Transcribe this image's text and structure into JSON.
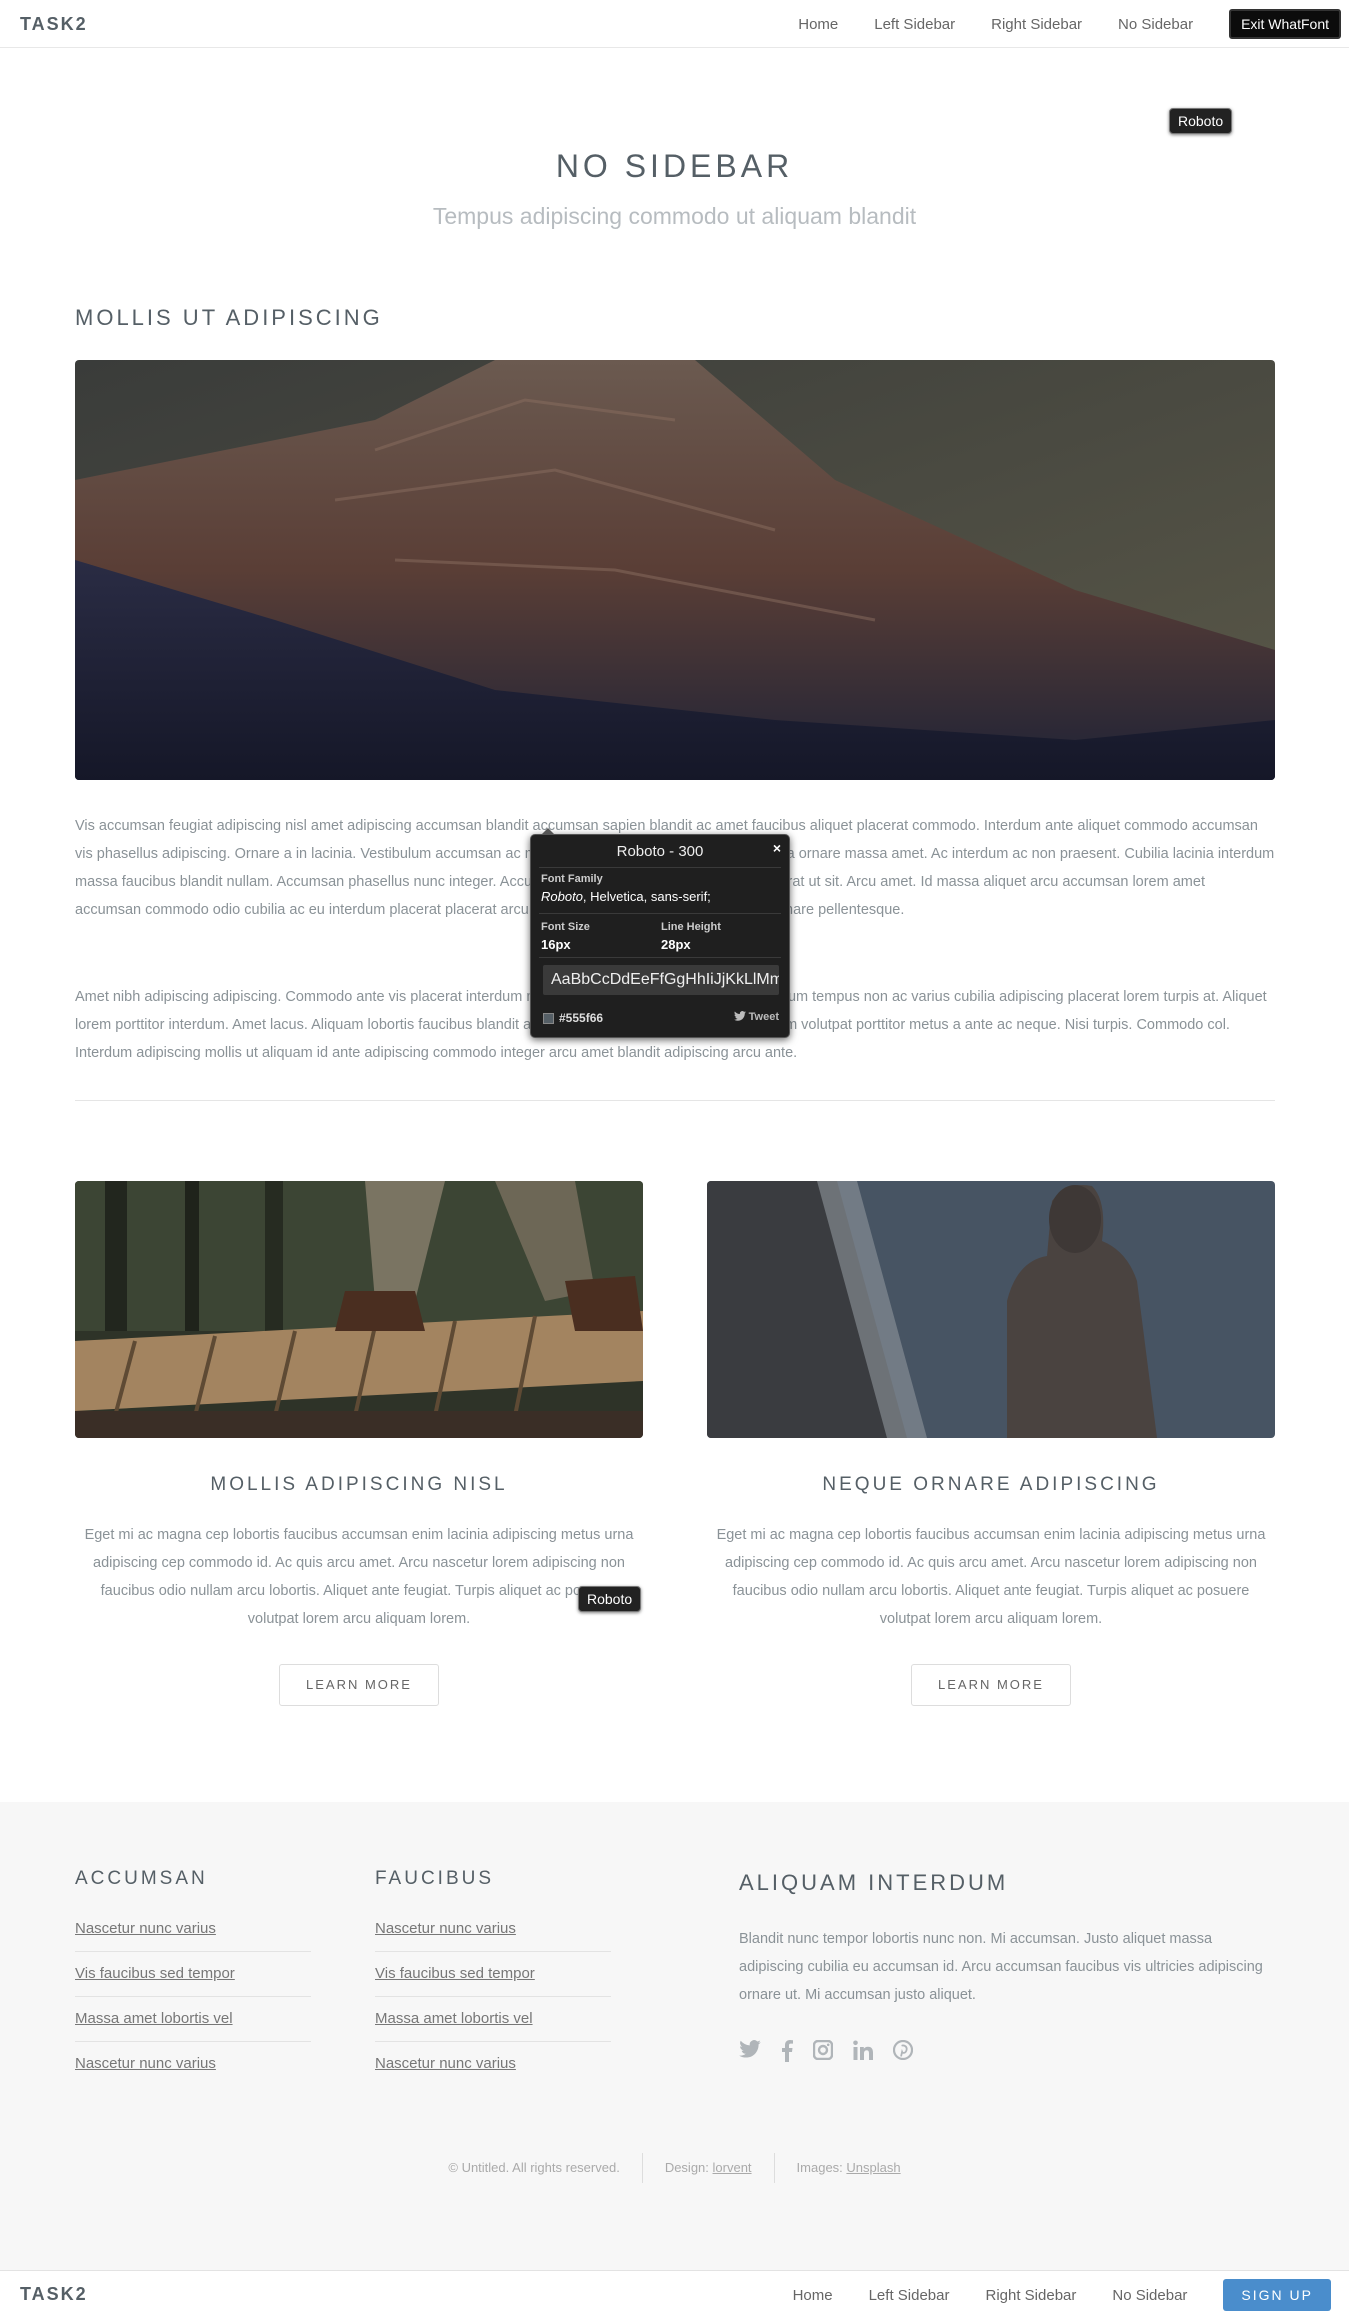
{
  "header": {
    "brand": "TASK2",
    "nav": [
      "Home",
      "Left Sidebar",
      "Right Sidebar",
      "No Sidebar"
    ],
    "exit_label": "Exit WhatFont"
  },
  "whatfont_tag": "Roboto",
  "hero": {
    "title": "NO SIDEBAR",
    "subtitle": "Tempus adipiscing commodo ut aliquam blandit"
  },
  "main": {
    "heading": "MOLLIS UT ADIPISCING",
    "para1": "Vis accumsan feugiat adipiscing nisl amet adipiscing accumsan blandit accumsan sapien blandit ac amet faucibus aliquet placerat commodo. Interdum ante aliquet commodo accumsan vis phasellus adipiscing. Ornare a in lacinia. Vestibulum accumsan ac metus massa tempor. Accumsan in lacinia ornare massa amet. Ac interdum ac non praesent. Cubilia lacinia interdum massa faucibus blandit nullam. Accumsan phasellus nunc integer. Accumsan euismod nunc adipiscing lacinia erat ut sit. Arcu amet. Id massa aliquet arcu accumsan lorem amet accumsan commodo odio cubilia ac eu interdum placerat placerat arcu commodo lobortis adipiscing semper ornare pellentesque.",
    "para2": "Amet nibh adipiscing adipiscing. Commodo ante vis placerat interdum massa massa primis. Tempus condimentum tempus non ac varius cubilia adipiscing placerat lorem turpis at. Aliquet lorem porttitor interdum. Amet lacus. Aliquam lobortis faucibus blandit ac phasellus. In amet magna non interdum volutpat porttitor metus a ante ac neque. Nisi turpis. Commodo col. Interdum adipiscing mollis ut aliquam id ante adipiscing commodo integer arcu amet blandit adipiscing arcu ante."
  },
  "popup": {
    "title": "Roboto - 300",
    "close": "×",
    "family_label": "Font Family",
    "family_first": "Roboto",
    "family_rest": ", Helvetica, sans-serif;",
    "size_label": "Font Size",
    "size_value": "16px",
    "lh_label": "Line Height",
    "lh_value": "28px",
    "sample": "AaBbCcDdEeFfGgHhIiJjKkLlMmNnOo",
    "color_hex": "#555f66",
    "tweet": "Tweet"
  },
  "cards": [
    {
      "title": "MOLLIS ADIPISCING NISL",
      "text": "Eget mi ac magna cep lobortis faucibus accumsan enim lacinia adipiscing metus urna adipiscing cep commodo id. Ac quis arcu amet. Arcu nascetur lorem adipiscing non faucibus odio nullam arcu lobortis. Aliquet ante feugiat. Turpis aliquet ac posuere volutpat lorem arcu aliquam lorem.",
      "button": "LEARN MORE"
    },
    {
      "title": "NEQUE ORNARE ADIPISCING",
      "text": "Eget mi ac magna cep lobortis faucibus accumsan enim lacinia adipiscing metus urna adipiscing cep commodo id. Ac quis arcu amet. Arcu nascetur lorem adipiscing non faucibus odio nullam arcu lobortis. Aliquet ante feugiat. Turpis aliquet ac posuere volutpat lorem arcu aliquam lorem.",
      "button": "LEARN MORE"
    }
  ],
  "footer": {
    "col1": {
      "heading": "ACCUMSAN",
      "links": [
        "Nascetur nunc varius",
        "Vis faucibus sed tempor",
        "Massa amet lobortis vel",
        "Nascetur nunc varius"
      ]
    },
    "col2": {
      "heading": "FAUCIBUS",
      "links": [
        "Nascetur nunc varius",
        "Vis faucibus sed tempor",
        "Massa amet lobortis vel",
        "Nascetur nunc varius"
      ]
    },
    "col3": {
      "heading": "ALIQUAM INTERDUM",
      "text": "Blandit nunc tempor lobortis nunc non. Mi accumsan. Justo aliquet massa adipiscing cubilia eu accumsan id. Arcu accumsan faucibus vis ultricies adipiscing ornare ut. Mi accumsan justo aliquet."
    },
    "social_icons": [
      "twitter-icon",
      "facebook-icon",
      "instagram-icon",
      "linkedin-icon",
      "pinterest-icon"
    ],
    "copyright": "© Untitled. All rights reserved.",
    "design_label": "Design:",
    "design_link": "lorvent",
    "images_label": "Images:",
    "images_link": "Unsplash"
  },
  "bottombar": {
    "brand": "TASK2",
    "nav": [
      "Home",
      "Left Sidebar",
      "Right Sidebar",
      "No Sidebar"
    ],
    "signup": "SIGN UP"
  }
}
